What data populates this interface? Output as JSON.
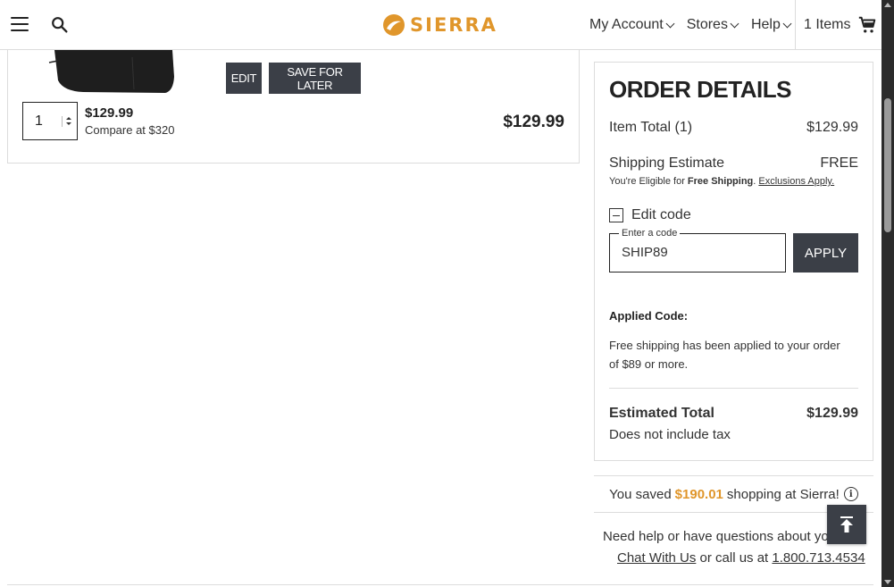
{
  "header": {
    "logo_text": "SIERRA",
    "nav": [
      {
        "label": "My Account"
      },
      {
        "label": "Stores"
      },
      {
        "label": "Help"
      }
    ],
    "cart_label": "1 Items"
  },
  "item": {
    "edit_label": "EDIT",
    "save_label": "SAVE FOR LATER",
    "quantity": "1",
    "price": "$129.99",
    "compare": "Compare at $320",
    "line_total": "$129.99"
  },
  "order": {
    "title": "ORDER DETAILS",
    "item_total_label": "Item Total (1)",
    "item_total_value": "$129.99",
    "shipping_label": "Shipping Estimate",
    "shipping_value": "FREE",
    "eligible_prefix": "You're Eligible for ",
    "eligible_bold": "Free Shipping",
    "eligible_period": ". ",
    "exclusions": "Exclusions Apply.",
    "edit_code_label": "Edit code",
    "code_legend": "Enter a code",
    "code_value": "SHIP89",
    "apply_label": "APPLY",
    "applied_label": "Applied Code:",
    "applied_msg": "Free shipping has been applied to your order of $89 or more.",
    "total_label": "Estimated Total",
    "total_value": "$129.99",
    "tax_note": "Does not include tax"
  },
  "savings": {
    "prefix": "You saved",
    "amount": "$190.01",
    "suffix": "shopping at Sierra!"
  },
  "help": {
    "line1": "Need help or have questions about your",
    "chat": "Chat With Us",
    "middle": " or call us at ",
    "phone": "1.800.713.4534"
  },
  "colors": {
    "accent": "#e0962b",
    "button_dark": "#3b3f47"
  },
  "icons": [
    "menu-icon",
    "search-icon",
    "cart-icon",
    "info-icon",
    "back-to-top-icon"
  ]
}
